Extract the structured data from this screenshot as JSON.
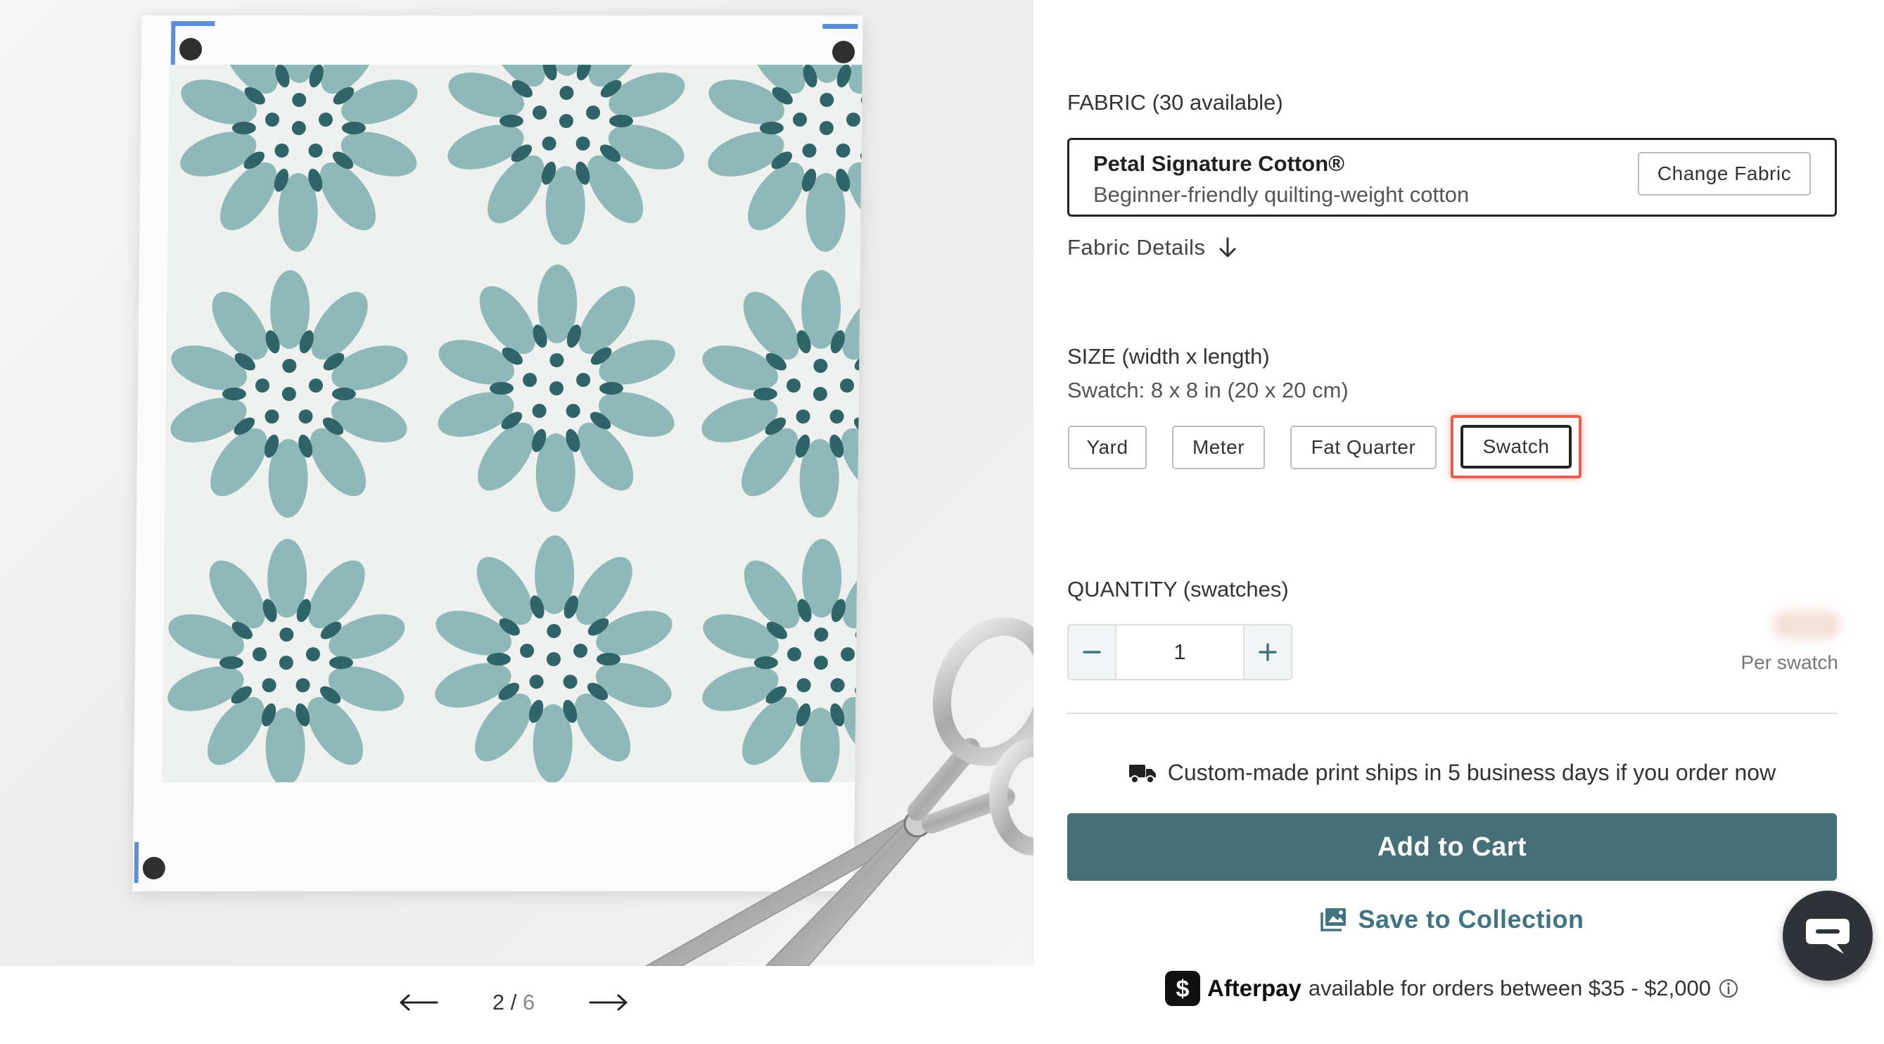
{
  "gallery": {
    "current": "2",
    "separator": "/",
    "total": "6",
    "prev_icon": "arrow-left-icon",
    "next_icon": "arrow-right-icon"
  },
  "fabric": {
    "label": "FABRIC (30 available)",
    "name": "Petal Signature Cotton®",
    "description": "Beginner-friendly quilting-weight cotton",
    "change_label": "Change Fabric",
    "details_label": "Fabric Details",
    "details_icon": "arrow-down-icon"
  },
  "size": {
    "label": "SIZE (width x length)",
    "selected_text": "Swatch: 8 x 8 in (20 x 20 cm)",
    "options": [
      "Yard",
      "Meter",
      "Fat Quarter",
      "Swatch"
    ],
    "selected": "Swatch"
  },
  "quantity": {
    "label": "QUANTITY (swatches)",
    "value": "1",
    "per_label": "Per swatch"
  },
  "shipping": {
    "icon": "truck-icon",
    "text": "Custom-made print ships in 5 business days if you order now"
  },
  "actions": {
    "add_to_cart": "Add to Cart",
    "save_to_collection": "Save to Collection",
    "save_icon": "image-collection-icon"
  },
  "afterpay": {
    "brand": "Afterpay",
    "text": "available for orders between $35 - $2,000",
    "info_icon": "info-icon"
  },
  "colors": {
    "primary_button": "#466f78",
    "link": "#3f7480",
    "highlight": "#e8604c",
    "pattern_light": "#8fb8b8",
    "pattern_dark": "#2f6468"
  },
  "chat": {
    "icon": "chat-bubble-icon"
  }
}
